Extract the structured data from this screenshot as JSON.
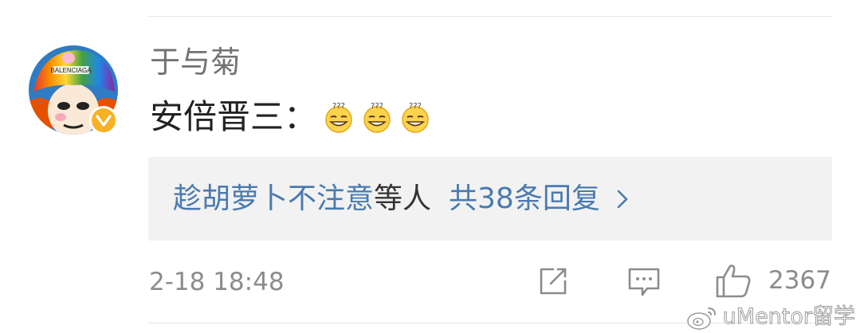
{
  "user": {
    "name": "于与菊",
    "verified": true
  },
  "comment": {
    "text": "安倍晋三：",
    "emoji_count": 3,
    "emoji": "sweat-grin-emoji"
  },
  "replies": {
    "names": "趁胡萝卜不注意",
    "suffix": "等人",
    "count_label": "共38条回复"
  },
  "footer": {
    "timestamp": "2-18 18:48",
    "like_count": "2367"
  },
  "watermark": {
    "text": "uMentor留学"
  },
  "colors": {
    "link": "#4a7ab0",
    "verified_badge": "#f7b124",
    "muted_text": "#8c8c8c"
  }
}
